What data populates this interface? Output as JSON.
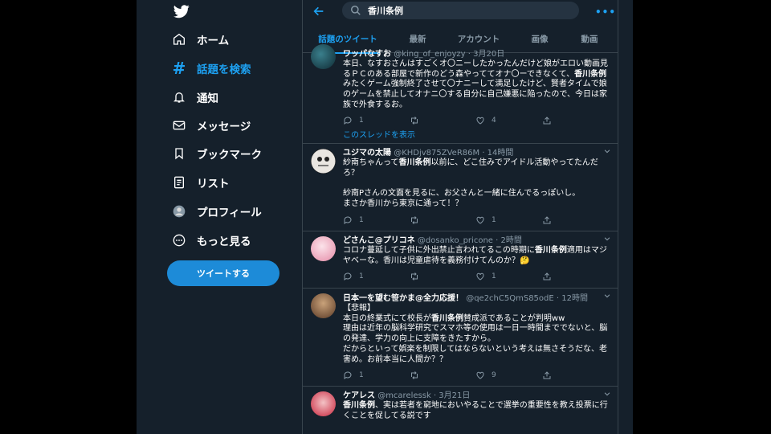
{
  "sidebar": {
    "items": [
      {
        "label": "ホーム"
      },
      {
        "label": "話題を検索"
      },
      {
        "label": "通知"
      },
      {
        "label": "メッセージ"
      },
      {
        "label": "ブックマーク"
      },
      {
        "label": "リスト"
      },
      {
        "label": "プロフィール"
      },
      {
        "label": "もっと見る"
      }
    ],
    "tweet_button": "ツイートする"
  },
  "search": {
    "query": "香川条例"
  },
  "header": {
    "more": "•••"
  },
  "tabs": [
    {
      "label": "話題のツイート"
    },
    {
      "label": "最新"
    },
    {
      "label": "アカウント"
    },
    {
      "label": "画像"
    },
    {
      "label": "動画"
    }
  ],
  "colors": {
    "background": "#15202b",
    "accent": "#1da1f2",
    "border": "#38444d"
  },
  "tweets": [
    {
      "name": "ワッパなすお",
      "handle": "@king_of_enjoyzy",
      "time": "· 3月20日",
      "body_pre": "本日、なすおさんはすごくオ〇ニーしたかったんだけど娘がエロい動画見るＰＣのある部屋で新作のどう森やっててオナ〇ーできなくて、",
      "body_kw": "香川条例",
      "body_post": "みたくゲーム強制終了させて〇ナニーして満足したけど、賢者タイムで娘のゲームを禁止してオナニ〇する自分に自己嫌悪に陥ったので、今日は家族で外食するお。",
      "reply": "1",
      "retweet": "",
      "like": "4",
      "thread": "このスレッドを表示"
    },
    {
      "name": "ユジマの太陽",
      "handle": "@KHDjv875ZVeR86M",
      "time": "· 14時間",
      "body_pre": "紗南ちゃんって",
      "body_kw": "香川条例",
      "body_post": "以前に、どこ住みでアイドル活動やってたんだろ？\n\n紗南Pさんの文面を見るに、お父さんと一緒に住んでるっぽいし。\nまさか香川から東京に通って！？",
      "reply": "1",
      "retweet": "",
      "like": "1"
    },
    {
      "name": "どさんこ@プリコネ",
      "handle": "@dosanko_pricone",
      "time": "· 2時間",
      "body_pre": "コロナ蔓延して子供に外出禁止言われてるこの時期に",
      "body_kw": "香川条例",
      "body_post": "適用はマジヤベーな。香川は児童虐待を義務付けてんのか？🤔",
      "reply": "1",
      "retweet": "",
      "like": "1"
    },
    {
      "name": "日本一を望む笹かま@全力応援！",
      "handle": "@qe2chC5QmS85odE",
      "time": "· 12時間",
      "body_pre": "【悲報】\n本日の終業式にて校長が",
      "body_kw": "香川条例",
      "body_post": "賛成派であることが判明ww\n理由は近年の脳科学研究でスマホ等の使用は一日一時間まででないと、脳の発達、学力の向上に支障をきたすから。\nだからといって娯楽を制限してはならないという考えは無さそうだな、老害め。お前本当に人間か？？",
      "reply": "1",
      "retweet": "",
      "like": "9"
    },
    {
      "name": "ケアレス",
      "handle": "@mcarelessk",
      "time": "· 3月21日",
      "body_pre": "",
      "body_kw": "香川条例",
      "body_post": "、実は若者を窮地においやることで選挙の重要性を教え投票に行くことを促してる説です",
      "reply": "",
      "retweet": "",
      "like": ""
    }
  ]
}
